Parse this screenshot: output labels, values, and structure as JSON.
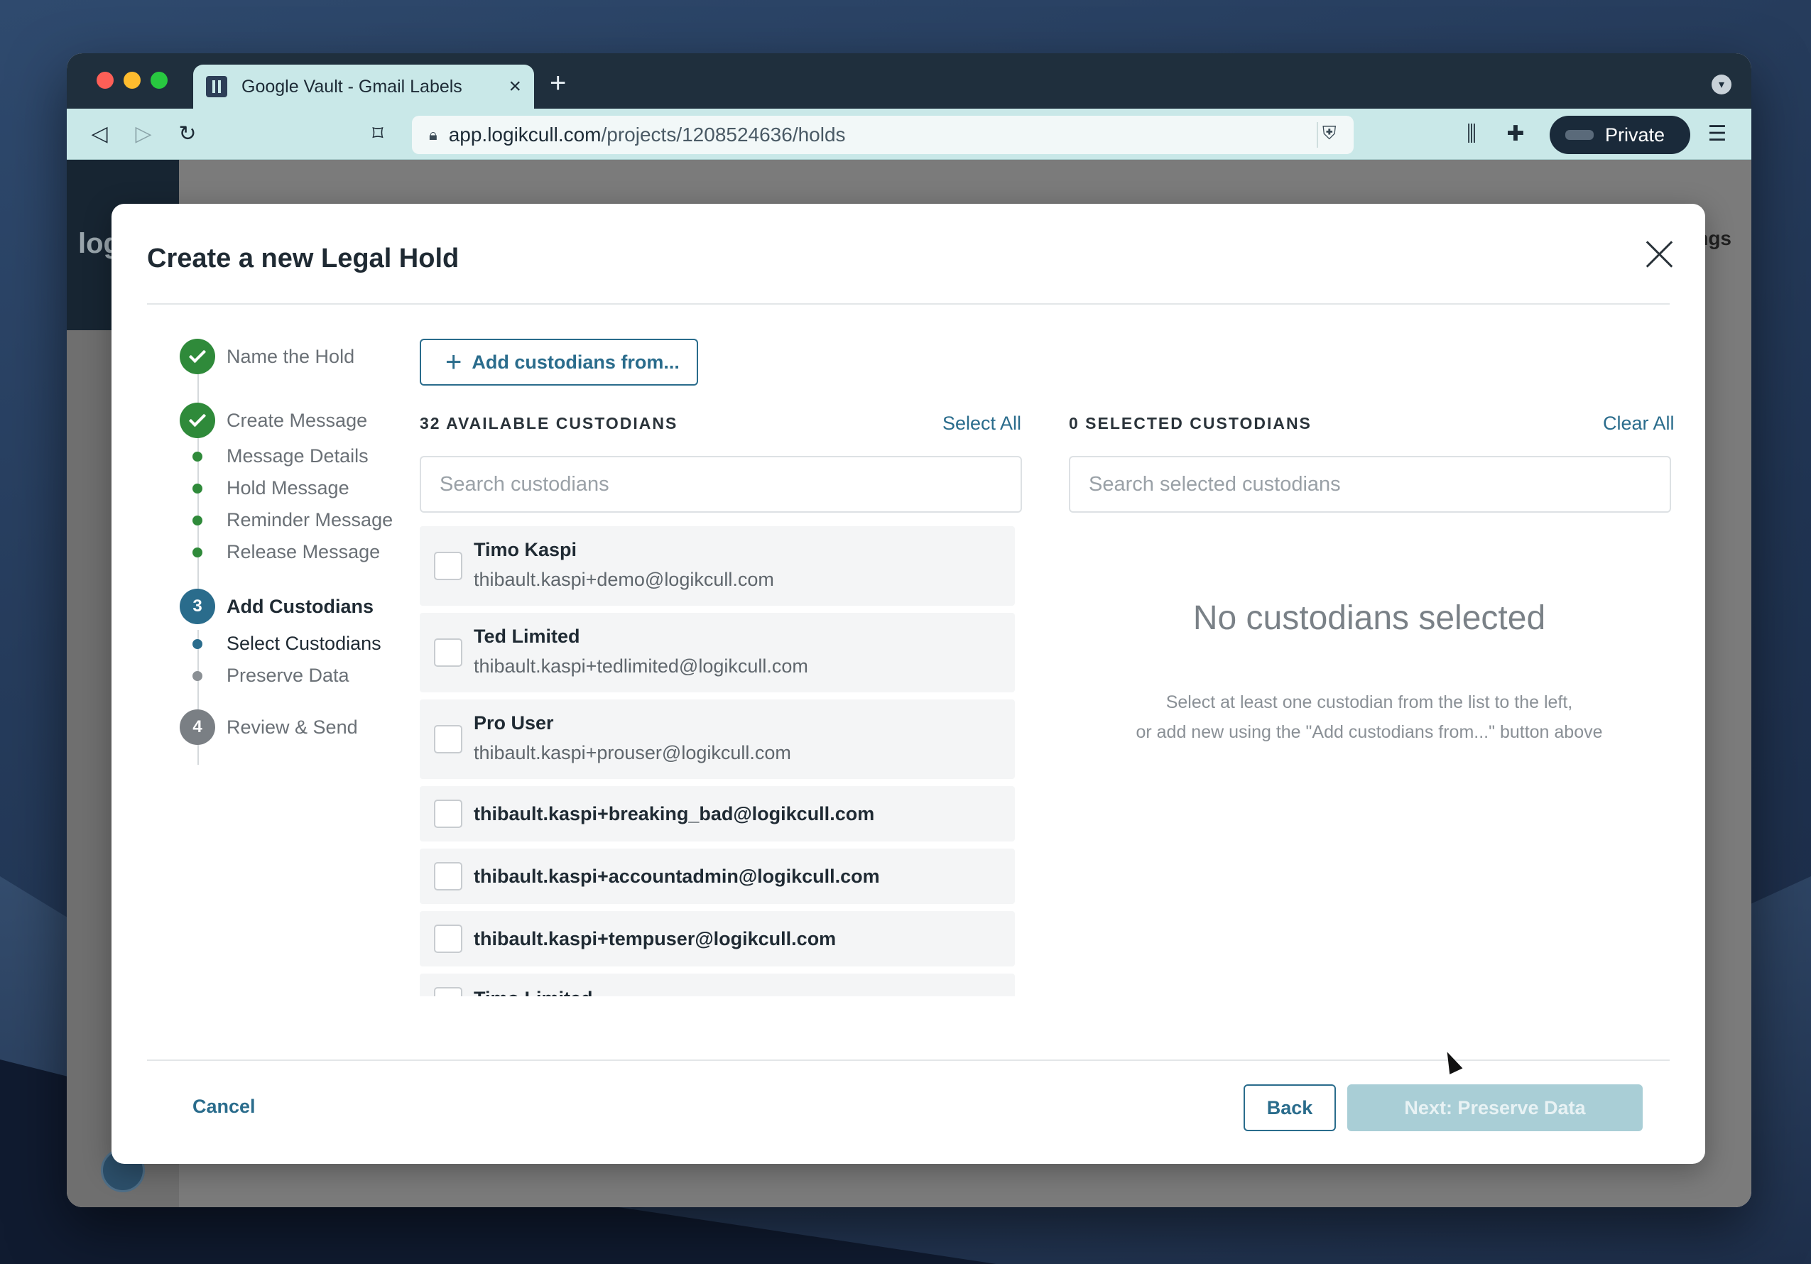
{
  "browser": {
    "tab_title": "Google Vault - Gmail Labels",
    "tab_close": "×",
    "new_tab": "+",
    "url_host": "app.logikcull.com",
    "url_path": "/projects/1208524636/holds",
    "private_label": "Private",
    "icons": [
      "back-icon",
      "forward-icon",
      "reload-icon",
      "bookmark-icon",
      "lock-icon",
      "brave-shield-icon",
      "extension-icon",
      "puzzle-icon",
      "menu-icon"
    ]
  },
  "page": {
    "logo_text": "log",
    "header_partial": "ngs"
  },
  "modal": {
    "title": "Create a new Legal Hold",
    "steps": [
      {
        "label": "Name the Hold",
        "status": "done"
      },
      {
        "label": "Create Message",
        "status": "done",
        "subs": [
          "Message Details",
          "Hold Message",
          "Reminder Message",
          "Release Message"
        ]
      },
      {
        "number": "3",
        "label": "Add Custodians",
        "status": "active",
        "subs": [
          "Select Custodians",
          "Preserve Data"
        ]
      },
      {
        "number": "4",
        "label": "Review & Send",
        "status": "pending"
      }
    ],
    "add_button": "Add custodians from...",
    "available": {
      "heading": "32 AVAILABLE CUSTODIANS",
      "select_all": "Select All",
      "search_placeholder": "Search custodians",
      "rows": [
        {
          "name": "Timo Kaspi",
          "email": "thibault.kaspi+demo@logikcull.com"
        },
        {
          "name": "Ted Limited",
          "email": "thibault.kaspi+tedlimited@logikcull.com"
        },
        {
          "name": "Pro User",
          "email": "thibault.kaspi+prouser@logikcull.com"
        },
        {
          "name": "thibault.kaspi+breaking_bad@logikcull.com"
        },
        {
          "name": "thibault.kaspi+accountadmin@logikcull.com"
        },
        {
          "name": "thibault.kaspi+tempuser@logikcull.com"
        },
        {
          "name": "Timo Limited"
        }
      ]
    },
    "selected": {
      "heading": "0 SELECTED CUSTODIANS",
      "clear_all": "Clear All",
      "search_placeholder": "Search selected custodians",
      "empty_title": "No custodians selected",
      "empty_line1": "Select at least one custodian from the list to the left,",
      "empty_line2": "or add new using the \"Add custodians from...\" button above"
    },
    "footer": {
      "cancel": "Cancel",
      "back": "Back",
      "next": "Next: Preserve Data"
    }
  }
}
